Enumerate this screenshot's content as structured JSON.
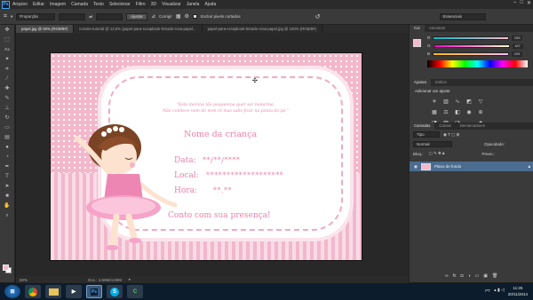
{
  "menu": {
    "app_logo": "Ps",
    "items": [
      "Arquivo",
      "Editar",
      "Imagem",
      "Camada",
      "Texto",
      "Selecionar",
      "Filtro",
      "3D",
      "Visualizar",
      "Janela",
      "Ajuda"
    ],
    "window_controls": [
      "–",
      "□",
      "✕"
    ]
  },
  "options_bar": {
    "style_label": "Proporção",
    "adjust_button": "Ajustar",
    "straighten_label": "Corrigir",
    "delete_pixels_label": "Excluir pixels cortados",
    "workspace": "Essenciais"
  },
  "tabs": [
    "papel.jpg @ 50% (RGB/8#)",
    "convite-tutorial @ 12,5% (papel-para-scrapbook-fetrado-rosa-papel...",
    "papel-para-scrapbook-fetrado-rosa-papel.jpg @ 100% (RGB/8#)"
  ],
  "document": {
    "quote_line1": "\"Esta menina tão pequenina quer ser bailarina.",
    "quote_line2": "Não conhece nem dó nem ré mas sabe ficar na ponta do pé.\"",
    "child_name": "Nome da criança",
    "date_label": "Data:",
    "date_value": "**/**/****",
    "place_label": "Local:",
    "place_value": "*******************",
    "time_label": "Hora:",
    "time_value": "**.**",
    "closing": "Conto com sua presença!"
  },
  "status_bar": {
    "zoom": "50%",
    "doc_info": "Doc.: 4,60M/4,60M"
  },
  "color_panel": {
    "tabs": [
      "Cor",
      "Amostras"
    ],
    "channels": [
      {
        "label": "R",
        "value": "255",
        "gradient": "#f1b8cc"
      },
      {
        "label": "G",
        "value": "187",
        "gradient": "#f4b9cf"
      },
      {
        "label": "B",
        "value": "205",
        "gradient": "#f4b9cf"
      }
    ]
  },
  "adjust_panel": {
    "tabs": [
      "Ajustes",
      "Estilos"
    ],
    "heading": "Adicionar um ajuste",
    "icons": [
      "brightness-icon",
      "levels-icon",
      "curves-icon",
      "exposure-icon",
      "vibrance-icon",
      "hue-icon",
      "balance-icon",
      "bw-icon",
      "photo-filter-icon",
      "channel-mixer-icon",
      "invert-icon",
      "posterize-icon",
      "threshold-icon",
      "gradient-map-icon",
      "selective-color-icon"
    ]
  },
  "layers_panel": {
    "tabs": [
      "Camadas",
      "Canais",
      "Demarcadores"
    ],
    "kind_filter": "Tipo",
    "blend_mode": "Normal",
    "opacity_label": "Opacidade:",
    "lock_label": "Bloq.:",
    "fill_label": "Preen.:",
    "layer_name": "Plano de fundo"
  },
  "taskbar": {
    "time": "11:25",
    "date": "20/11/2014",
    "lang": "PT",
    "apps": [
      "start",
      "chrome",
      "explorer",
      "media",
      "photoshop",
      "skype",
      "camtasia"
    ]
  }
}
